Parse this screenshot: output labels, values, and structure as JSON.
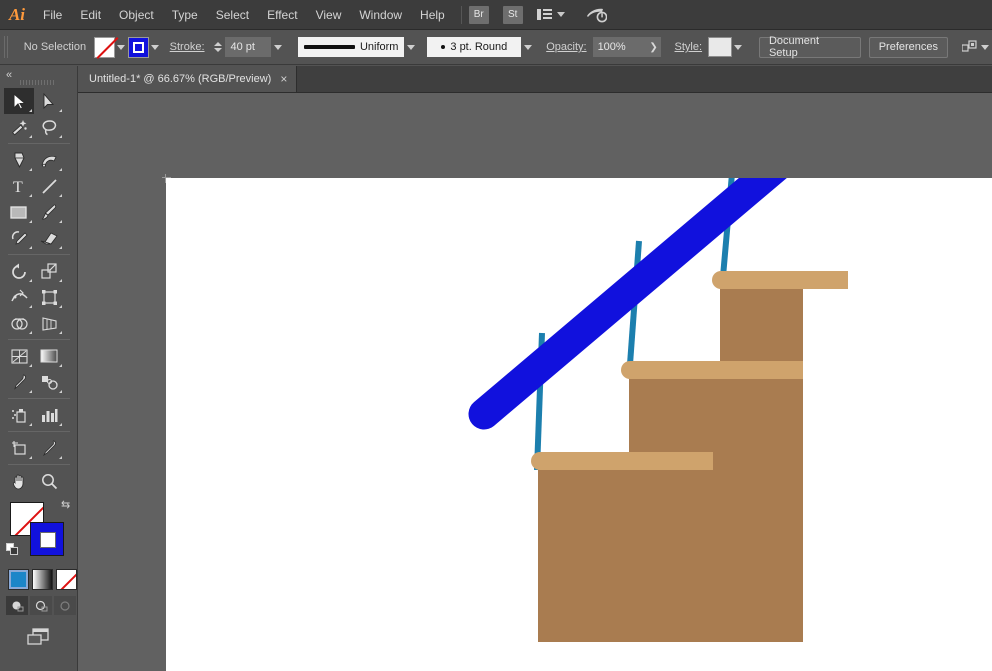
{
  "app": {
    "name": "Adobe Illustrator",
    "logo_text": "Ai"
  },
  "menubar": {
    "items": [
      {
        "label": "File"
      },
      {
        "label": "Edit"
      },
      {
        "label": "Object"
      },
      {
        "label": "Type"
      },
      {
        "label": "Select"
      },
      {
        "label": "Effect"
      },
      {
        "label": "View"
      },
      {
        "label": "Window"
      },
      {
        "label": "Help"
      }
    ],
    "bridge_button": "Br",
    "stock_button": "St",
    "workspace_icon": "workspace-switcher-icon",
    "search_icon": "search-adobe-stock-icon"
  },
  "controlbar": {
    "selection_status": "No Selection",
    "fill_swatch": "none",
    "stroke_swatch_color": "#1111dd",
    "stroke_label": "Stroke:",
    "stroke_weight": "40 pt",
    "stroke_profile": "Uniform",
    "brush_definition": "3 pt. Round",
    "opacity_label": "Opacity:",
    "opacity_value": "100%",
    "style_label": "Style:",
    "document_setup_button": "Document Setup",
    "preferences_button": "Preferences",
    "align_icon": "align-objects-icon"
  },
  "tabbar": {
    "tabs": [
      {
        "title": "Untitled-1* @ 66.67% (RGB/Preview)",
        "close": "×",
        "active": true
      }
    ]
  },
  "toolbar": {
    "collapse_label": "«",
    "tools": [
      {
        "name": "selection-tool",
        "selected": true
      },
      {
        "name": "direct-selection-tool",
        "selected": false
      },
      {
        "name": "magic-wand-tool",
        "selected": false
      },
      {
        "name": "lasso-tool",
        "selected": false
      },
      {
        "name": "pen-tool",
        "selected": false
      },
      {
        "name": "curvature-tool",
        "selected": false
      },
      {
        "name": "type-tool",
        "selected": false
      },
      {
        "name": "line-segment-tool",
        "selected": false
      },
      {
        "name": "rectangle-tool",
        "selected": false
      },
      {
        "name": "paintbrush-tool",
        "selected": false
      },
      {
        "name": "shaper-pencil-tool",
        "selected": false
      },
      {
        "name": "eraser-tool",
        "selected": false
      },
      {
        "name": "rotate-tool",
        "selected": false
      },
      {
        "name": "scale-tool",
        "selected": false
      },
      {
        "name": "width-warp-tool",
        "selected": false
      },
      {
        "name": "free-transform-tool",
        "selected": false
      },
      {
        "name": "shape-builder-tool",
        "selected": false
      },
      {
        "name": "perspective-grid-tool",
        "selected": false
      },
      {
        "name": "mesh-tool",
        "selected": false
      },
      {
        "name": "gradient-tool",
        "selected": false
      },
      {
        "name": "eyedropper-tool",
        "selected": false
      },
      {
        "name": "blend-tool",
        "selected": false
      },
      {
        "name": "symbol-sprayer-tool",
        "selected": false
      },
      {
        "name": "column-graph-tool",
        "selected": false
      },
      {
        "name": "artboard-tool",
        "selected": false
      },
      {
        "name": "slice-tool",
        "selected": false
      },
      {
        "name": "hand-tool",
        "selected": false
      },
      {
        "name": "zoom-tool",
        "selected": false
      }
    ],
    "color_controls": {
      "fill": "none",
      "stroke": "#1111dd",
      "swap_icon": "swap-fill-stroke-icon",
      "default_icon": "default-fill-stroke-icon",
      "modes": [
        {
          "name": "color-mode-button",
          "active": true
        },
        {
          "name": "gradient-mode-button",
          "active": false
        },
        {
          "name": "none-mode-button",
          "active": false
        }
      ],
      "draw_modes": [
        {
          "name": "draw-normal-button",
          "active": true
        },
        {
          "name": "draw-behind-button",
          "active": false
        },
        {
          "name": "draw-inside-button",
          "active": false
        }
      ],
      "screen_mode": "change-screen-mode-button"
    }
  },
  "canvas": {
    "background": "#616161",
    "artboard_background": "#ffffff",
    "zoom_level": "66.67%",
    "artwork": {
      "title": "staircase-with-handrail",
      "colors": {
        "handrail": "#1111dd",
        "baluster": "#1c7fae",
        "step_body": "#a97c50",
        "step_nosing": "#cfa36c"
      },
      "steps": [
        {
          "name": "bottom-step"
        },
        {
          "name": "middle-step"
        },
        {
          "name": "top-step"
        }
      ],
      "balusters": [
        {
          "name": "baluster-left"
        },
        {
          "name": "baluster-middle"
        },
        {
          "name": "baluster-right"
        }
      ],
      "handrail": {
        "name": "handrail-bar"
      }
    }
  }
}
